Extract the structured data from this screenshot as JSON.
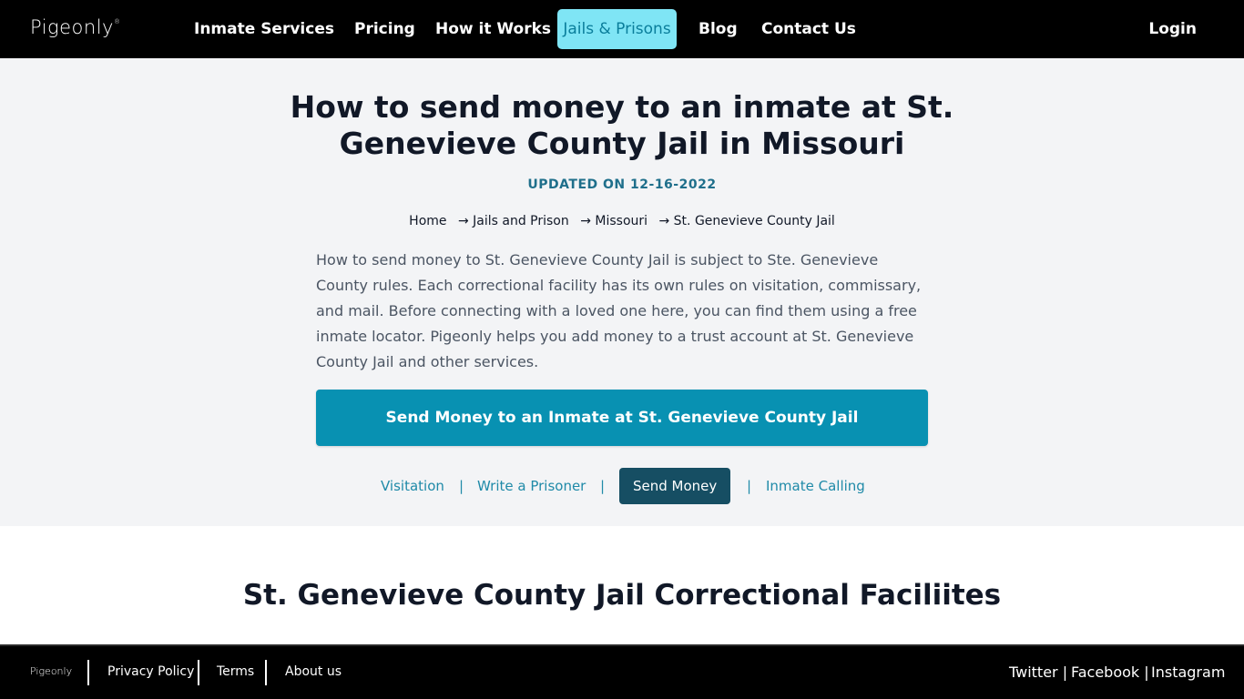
{
  "nav": {
    "logo": "Pigeonly",
    "items": [
      {
        "label": "Inmate Services",
        "active": false
      },
      {
        "label": "Pricing",
        "active": false
      },
      {
        "label": "How it Works",
        "active": false
      },
      {
        "label": "Jails & Prisons",
        "active": true
      },
      {
        "label": "Blog",
        "active": false
      },
      {
        "label": "Contact Us",
        "active": false
      }
    ],
    "login": "Login"
  },
  "hero": {
    "title": "How to send money to an inmate at St. Genevieve County Jail in Missouri",
    "updated": "UPDATED ON 12-16-2022",
    "breadcrumb": [
      "Home",
      "→ Jails and Prison",
      "→ Missouri",
      "→ St. Genevieve County Jail"
    ],
    "intro": "How to send money to St. Genevieve County Jail is subject to Ste. Genevieve County rules. Each correctional facility has its own rules on visitation, commissary, and mail. Before connecting with a loved one here, you can find them using a free inmate locator. Pigeonly helps you add money to a trust account at St. Genevieve County Jail and other services.",
    "cta": "Send Money to an Inmate at St. Genevieve County Jail",
    "tabs": [
      {
        "label": "Visitation",
        "active": false
      },
      {
        "label": "Write a Prisoner",
        "active": false
      },
      {
        "label": "Send Money",
        "active": true
      },
      {
        "label": "Inmate Calling",
        "active": false
      }
    ],
    "separator": "|"
  },
  "facilities": {
    "title": "St. Genevieve County Jail Correctional Faciliites"
  },
  "footer": {
    "logo": "Pigeonly",
    "links": [
      "Privacy Policy",
      "Terms",
      "About us"
    ],
    "social": [
      "Twitter |",
      "Facebook |",
      "Instagram"
    ]
  },
  "colors": {
    "nav_bg": "#000000",
    "active_nav_bg": "#7fe5f5",
    "hero_bg": "#f3f4f6",
    "cta_bg": "#0891b2",
    "active_tab_bg": "#164e63",
    "link": "#1f8aa8"
  }
}
